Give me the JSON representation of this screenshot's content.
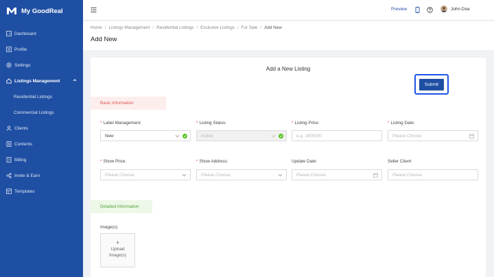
{
  "app": {
    "name": "My GoodReal"
  },
  "sidebar": {
    "items": [
      {
        "label": "Dashboard",
        "icon": "dashboard-icon"
      },
      {
        "label": "Profile",
        "icon": "profile-icon"
      },
      {
        "label": "Settings",
        "icon": "settings-icon"
      },
      {
        "label": "Listings Management",
        "icon": "home-icon",
        "expanded": true,
        "active": true
      },
      {
        "label": "Residential Listings",
        "sub": true
      },
      {
        "label": "Commercial Listings",
        "sub": true
      },
      {
        "label": "Clients",
        "icon": "clients-icon"
      },
      {
        "label": "Contents",
        "icon": "contents-icon"
      },
      {
        "label": "Billing",
        "icon": "billing-icon"
      },
      {
        "label": "Invite & Earn",
        "icon": "share-icon"
      },
      {
        "label": "Templates",
        "icon": "templates-icon"
      }
    ]
  },
  "topbar": {
    "preview": "Preview",
    "user": "John Doe"
  },
  "breadcrumb": [
    "Home",
    "Listings Management",
    "Residential Listings",
    "Exclusive Listings",
    "For Sale",
    "Add New"
  ],
  "page_title": "Add New",
  "form": {
    "title": "Add a New Listing",
    "submit": "Submit",
    "section_basic": "Basic Information",
    "section_detailed": "Detailed Information",
    "fields": {
      "label_management": {
        "label": "Label Management:",
        "required": true,
        "value": "New"
      },
      "listing_status": {
        "label": "Listing Status:",
        "required": true,
        "value": "Active",
        "disabled": true
      },
      "listing_price": {
        "label": "Listing Price:",
        "required": true,
        "placeholder": "e.g. 1800000"
      },
      "listing_date": {
        "label": "Listing Date:",
        "required": true,
        "placeholder": "Please Choose"
      },
      "show_price": {
        "label": "Show Price:",
        "required": true,
        "placeholder": "Please Choose"
      },
      "show_address": {
        "label": "Show Address:",
        "required": true,
        "placeholder": "Please Choose"
      },
      "update_date": {
        "label": "Update Date:",
        "required": false,
        "placeholder": "Please Choose"
      },
      "seller_client": {
        "label": "Seller Client:",
        "required": false,
        "placeholder": "Please Choose"
      }
    },
    "images": {
      "label": "Image(s):",
      "upload_plus": "+",
      "upload_text": "Upload Image(s)"
    }
  },
  "colors": {
    "sidebar": "#1f4fa3",
    "accent": "#1f4fa3",
    "highlight": "#1a53e8",
    "success": "#52c41a",
    "required": "#e84c3d"
  }
}
